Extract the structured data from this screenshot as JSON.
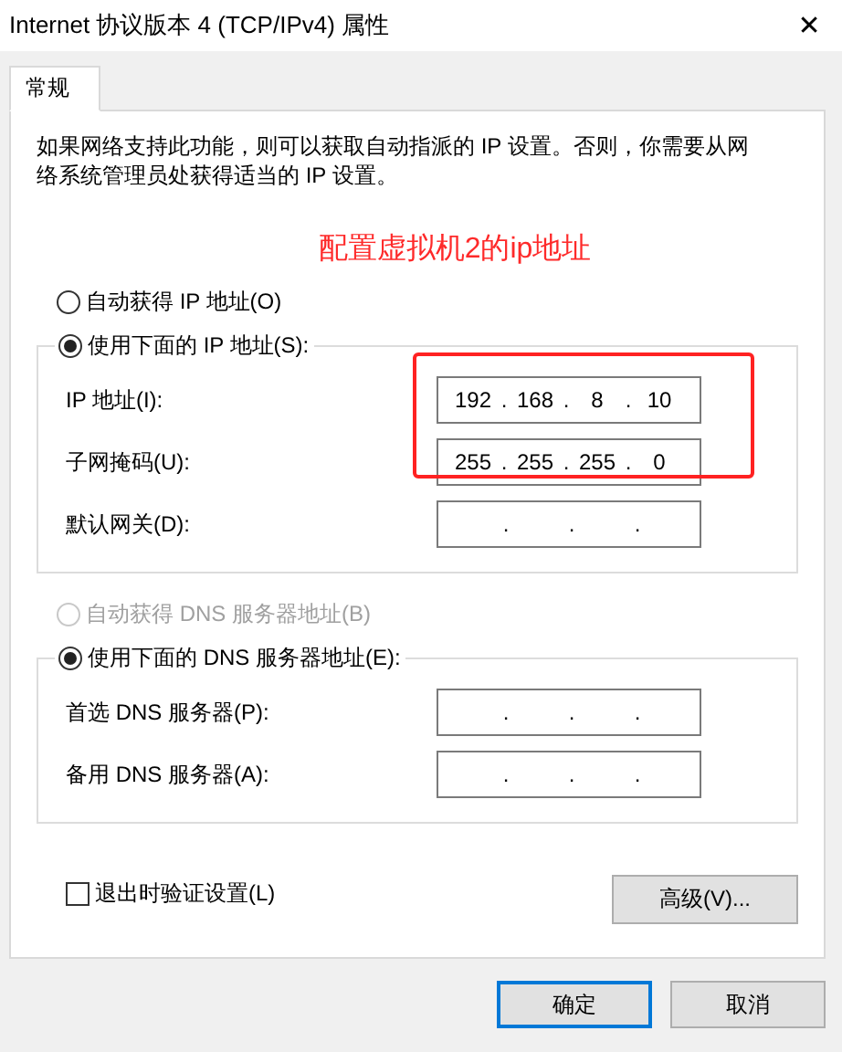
{
  "window": {
    "title": "Internet 协议版本 4 (TCP/IPv4) 属性",
    "close": "✕"
  },
  "tabs": [
    {
      "label": "常规",
      "selected": true
    }
  ],
  "description": "如果网络支持此功能，则可以获取自动指派的 IP 设置。否则，你需要从网络系统管理员处获得适当的 IP 设置。",
  "annotation": "配置虚拟机2的ip地址",
  "ip_auto": {
    "label": "自动获得 IP 地址(O)",
    "selected": false,
    "disabled": false
  },
  "ip_manual": {
    "label": "使用下面的 IP 地址(S):",
    "selected": true,
    "disabled": false,
    "fields": [
      {
        "label": "IP 地址(I):",
        "parts": [
          "192",
          ".",
          "168",
          ".",
          "8",
          ".",
          "10"
        ],
        "highlighted": true
      },
      {
        "label": "子网掩码(U):",
        "parts": [
          "255",
          ".",
          "255",
          ".",
          "255",
          ".",
          "0"
        ],
        "highlighted": true
      },
      {
        "label": "默认网关(D):",
        "parts": [
          ".",
          ".",
          "."
        ],
        "highlighted": false
      }
    ]
  },
  "dns_auto": {
    "label": "自动获得 DNS 服务器地址(B)",
    "selected": false,
    "disabled": true
  },
  "dns_manual": {
    "label": "使用下面的 DNS 服务器地址(E):",
    "selected": true,
    "disabled": false,
    "fields": [
      {
        "label": "首选 DNS 服务器(P):",
        "parts": [
          ".",
          ".",
          "."
        ],
        "highlighted": false
      },
      {
        "label": "备用 DNS 服务器(A):",
        "parts": [
          ".",
          ".",
          "."
        ],
        "highlighted": false
      }
    ]
  },
  "validate": {
    "label": "退出时验证设置(L)",
    "checked": false
  },
  "advanced_button": "高级(V)...",
  "buttons": [
    {
      "label": "确定",
      "default": true
    },
    {
      "label": "取消",
      "default": false
    }
  ]
}
